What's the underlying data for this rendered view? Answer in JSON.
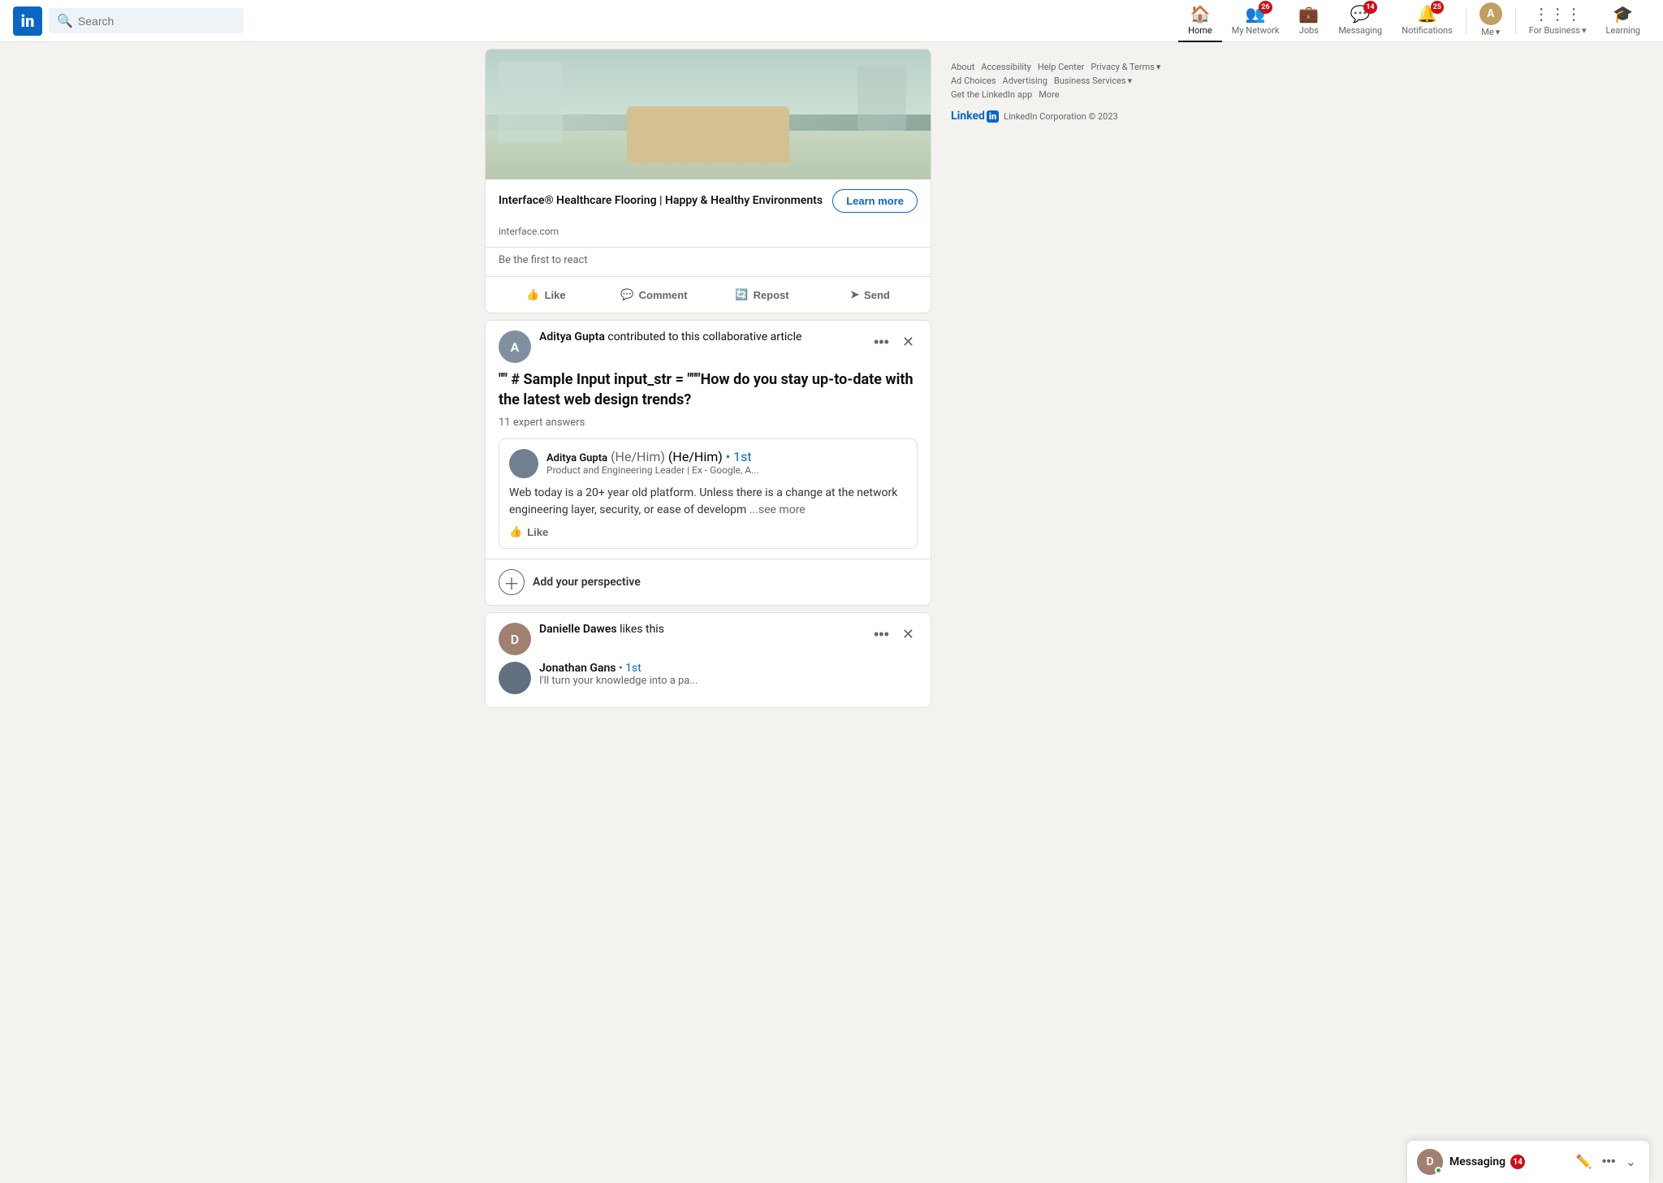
{
  "navbar": {
    "logo": "in",
    "search_placeholder": "Search",
    "nav_items": [
      {
        "id": "home",
        "label": "Home",
        "icon": "🏠",
        "badge": null,
        "active": true
      },
      {
        "id": "my-network",
        "label": "My Network",
        "icon": "👥",
        "badge": "26",
        "active": false
      },
      {
        "id": "jobs",
        "label": "Jobs",
        "icon": "💼",
        "badge": null,
        "active": false
      },
      {
        "id": "messaging",
        "label": "Messaging",
        "icon": "💬",
        "badge": "14",
        "active": false
      },
      {
        "id": "notifications",
        "label": "Notifications",
        "icon": "🔔",
        "badge": "25",
        "active": false
      }
    ],
    "me_label": "Me",
    "for_business_label": "For Business",
    "learning_label": "Learning"
  },
  "ad_card": {
    "title": "Interface® Healthcare Flooring | Happy & Healthy Environments",
    "domain": "interface.com",
    "learn_more": "Learn more"
  },
  "ad_actions": {
    "like": "Like",
    "comment": "Comment",
    "repost": "Repost",
    "send": "Send",
    "reaction_text": "Be the first to react"
  },
  "collab_post": {
    "author": "Aditya Gupta",
    "contributed_text": "contributed to this collaborative article",
    "more_icon": "•••",
    "article_title": "\"\" # Sample Input input_str = \"\"\"How do you stay up-to-date with the latest web design trends?",
    "expert_count": "11 expert answers",
    "answer": {
      "author_name": "Aditya Gupta",
      "pronouns": "(He/Him)",
      "degree": "• 1st",
      "author_title": "Product and Engineering Leader | Ex - Google, A...",
      "body": "Web today is a 20+ year old platform. Unless there is a change at the network engineering layer, security, or ease of developm",
      "see_more": "...see more",
      "like_label": "Like"
    },
    "add_perspective": "Add your perspective"
  },
  "third_card": {
    "person_name": "Danielle Dawes",
    "likes_text": "likes this",
    "second_person": "Jonathan Gans",
    "second_degree": "• 1st",
    "second_preview": "I'll turn your knowledge into a pa..."
  },
  "footer": {
    "links": [
      "About",
      "Accessibility",
      "Help Center",
      "Privacy & Terms",
      "Ad Choices",
      "Advertising",
      "Business Services",
      "Get the LinkedIn app",
      "More"
    ],
    "privacy_dropdown": "Privacy & Terms",
    "business_dropdown": "Business Services",
    "copyright": "LinkedIn Corporation © 2023"
  },
  "messaging_widget": {
    "title": "Messaging",
    "badge": "14",
    "avatar_initials": "D"
  }
}
